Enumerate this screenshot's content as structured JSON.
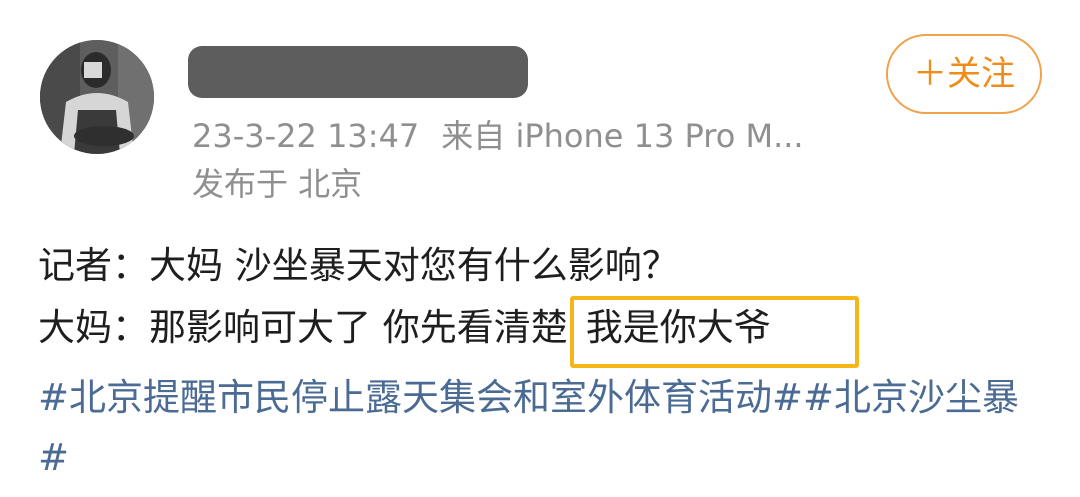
{
  "post": {
    "avatar_icon": "user-avatar-photo",
    "username_redacted": true,
    "follow_label": "＋关注",
    "timestamp": "23-3-22 13:47",
    "source": "来自 iPhone 13 Pro M...",
    "location": "发布于 北京",
    "lines": [
      {
        "speaker": "记者：",
        "text": "大妈 沙坐暴天对您有什么影响？"
      },
      {
        "speaker": "大妈：",
        "text": "那影响可大了 你先看清楚",
        "highlight": "我是你大爷"
      }
    ],
    "hashtags": [
      "#北京提醒市民停止露天集会和室外体育活动#",
      "#北京沙尘暴#"
    ]
  },
  "colors": {
    "follow_accent": "#f08c1a",
    "highlight_border": "#f5b617",
    "hashtag": "#4b6b95",
    "meta_text": "#8f8f8f",
    "redaction": "#5d5d5d"
  }
}
